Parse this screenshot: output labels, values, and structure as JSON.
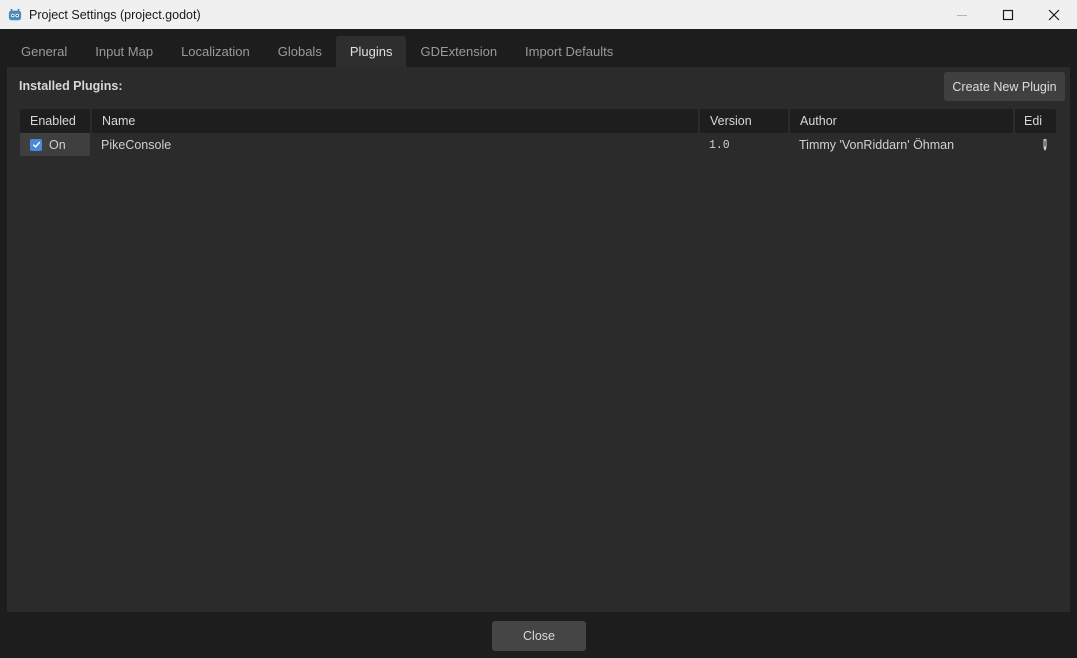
{
  "window": {
    "title": "Project Settings (project.godot)",
    "app_icon": "godot-icon",
    "controls": [
      "minimize-icon",
      "maximize-icon",
      "close-icon"
    ]
  },
  "tabs": [
    {
      "label": "General"
    },
    {
      "label": "Input Map"
    },
    {
      "label": "Localization"
    },
    {
      "label": "Globals"
    },
    {
      "label": "Plugins",
      "active": true
    },
    {
      "label": "GDExtension"
    },
    {
      "label": "Import Defaults"
    }
  ],
  "plugins_panel": {
    "installed_label": "Installed Plugins:",
    "create_button": "Create New Plugin",
    "columns": [
      "Enabled",
      "Name",
      "Version",
      "Author",
      "Edi"
    ],
    "rows": [
      {
        "enabled": true,
        "enabled_label": "On",
        "name": "PikeConsole",
        "version": "1.0",
        "author": "Timmy 'VonRiddarn' Öhman",
        "edit_icon": "pencil-icon"
      }
    ]
  },
  "footer": {
    "close_button": "Close"
  },
  "colors": {
    "titlebar_bg": "#f0f0f0",
    "window_bg": "#1d1d1d",
    "panel_bg": "#2b2b2b",
    "header_bg": "#1e1e1e",
    "checkbox_accent": "#4a8ad6"
  }
}
